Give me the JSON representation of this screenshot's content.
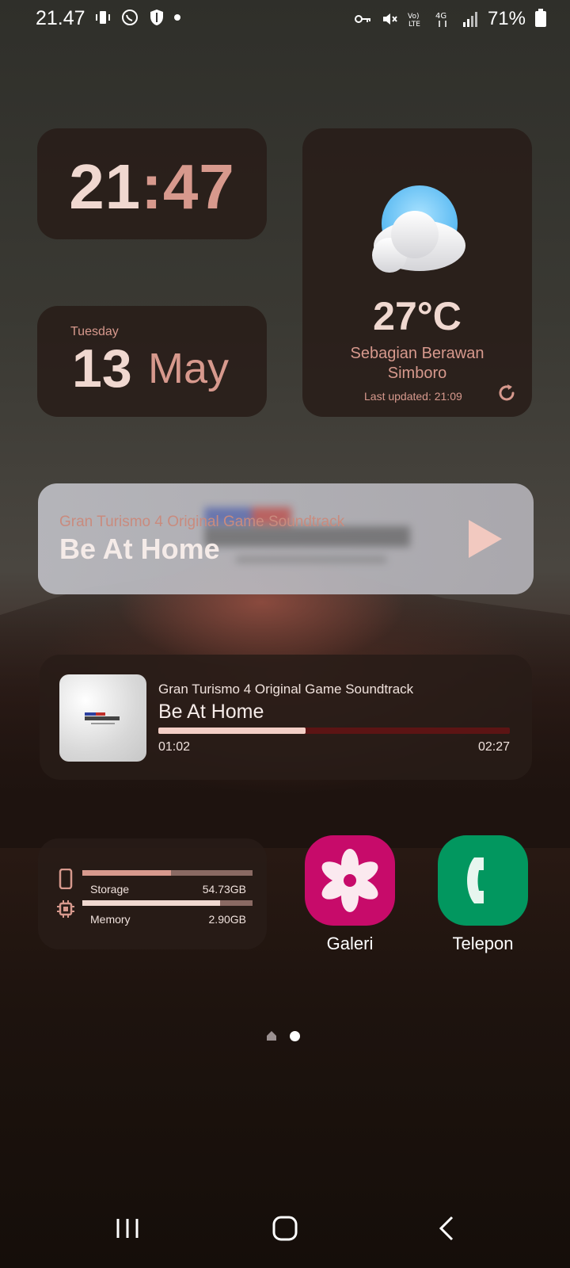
{
  "status_bar": {
    "time": "21.47",
    "battery": "71%"
  },
  "clock": {
    "hour": "21",
    "sep": ":",
    "minute": "47"
  },
  "date": {
    "weekday": "Tuesday",
    "day": "13",
    "month": "May"
  },
  "weather": {
    "temperature": "27°C",
    "condition": "Sebagian Berawan",
    "location": "Simboro",
    "last_updated": "Last updated: 21:09"
  },
  "music_widget_large": {
    "album": "Gran Turismo 4 Original Game Soundtrack",
    "title": "Be At Home"
  },
  "music_widget_small": {
    "album": "Gran Turismo 4 Original Game Soundtrack",
    "title": "Be At Home",
    "current_time": "01:02",
    "duration": "02:27",
    "progress": 0.42
  },
  "system": {
    "storage": {
      "label": "Storage",
      "value": "54.73GB",
      "fill": 0.52
    },
    "memory": {
      "label": "Memory",
      "value": "2.90GB",
      "fill": 0.81
    }
  },
  "apps": [
    {
      "name": "Galeri",
      "color": "#c70b6a"
    },
    {
      "name": "Telepon",
      "color": "#02975f"
    }
  ],
  "colors": {
    "accent": "#d7998d",
    "light": "#f0d8d0",
    "progress_bg": "#5c1414"
  }
}
